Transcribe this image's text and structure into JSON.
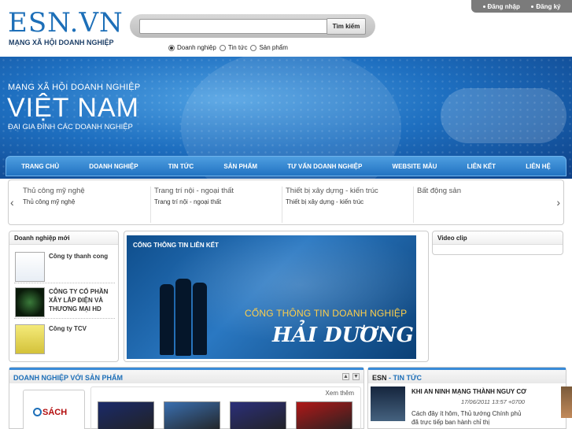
{
  "brand": {
    "logo": "ESN.VN",
    "tagline": "MẠNG XÃ HỘI DOANH NGHIỆP"
  },
  "topbar": {
    "login": "Đăng nhập",
    "register": "Đăng ký"
  },
  "search": {
    "value": "",
    "placeholder": "",
    "button": "Tìm kiếm",
    "options": [
      {
        "label": "Doanh nghiệp",
        "checked": true
      },
      {
        "label": "Tin tức",
        "checked": false
      },
      {
        "label": "Sản phẩm",
        "checked": false
      }
    ]
  },
  "banner": {
    "line1": "MẠNG XÃ HỘI DOANH NGHIỆP",
    "line2": "VIỆT NAM",
    "line3": "ĐẠI GIA ĐÌNH CÁC DOANH NGHIỆP"
  },
  "nav": [
    "TRANG CHỦ",
    "DOANH NGHIỆP",
    "TIN TỨC",
    "SẢN PHẨM",
    "TƯ VẤN DOANH NGHIỆP",
    "WEBSITE MẪU",
    "LIÊN KẾT",
    "LIÊN HỆ"
  ],
  "carousel": {
    "prev": "‹",
    "next": "›",
    "items": [
      {
        "title": "Thủ công mỹ nghệ",
        "sub": "Thủ công mỹ nghệ"
      },
      {
        "title": "Trang trí nội - ngoại thất",
        "sub": "Trang trí nội - ngoại thất"
      },
      {
        "title": "Thiết bị xây dựng - kiến trúc",
        "sub": "Thiết bị xây dựng - kiến trúc"
      },
      {
        "title": "Bất động sản",
        "sub": ""
      }
    ]
  },
  "dn_moi": {
    "title": "Doanh nghiệp mới",
    "items": [
      {
        "name": "Công ty thanh cong"
      },
      {
        "name": "CÔNG TY CỔ PHẦN XÂY LẮP ĐIỆN VÀ THƯƠNG MẠI HD"
      },
      {
        "name": "Công ty TCV"
      }
    ]
  },
  "cttt": {
    "label": "CỔNG THÔNG TIN LIÊN KẾT",
    "title1": "CỔNG THÔNG TIN DOANH NGHIỆP",
    "title2": "HẢI DƯƠNG"
  },
  "video": {
    "title": "Video clip"
  },
  "dnsp": {
    "title": "DOANH NGHIỆP VỚI SẢN PHẨM",
    "more": "Xem thêm",
    "logo": "SÁCH",
    "books": [
      {
        "color": "#1a2a6a"
      },
      {
        "color": "#3a6fb0"
      },
      {
        "color": "#2b2f7a"
      },
      {
        "color": "#b01818"
      }
    ]
  },
  "news": {
    "title_a": "ESN",
    "title_b": "TIN TỨC",
    "headline": "KHI AN NINH MẠNG THÀNH NGUY CƠ",
    "date": "17/06/2011 13:57 +0700",
    "summary": "Cách đây ít hôm, Thủ tướng Chính phủ đã trực tiếp ban hành chỉ thị"
  }
}
